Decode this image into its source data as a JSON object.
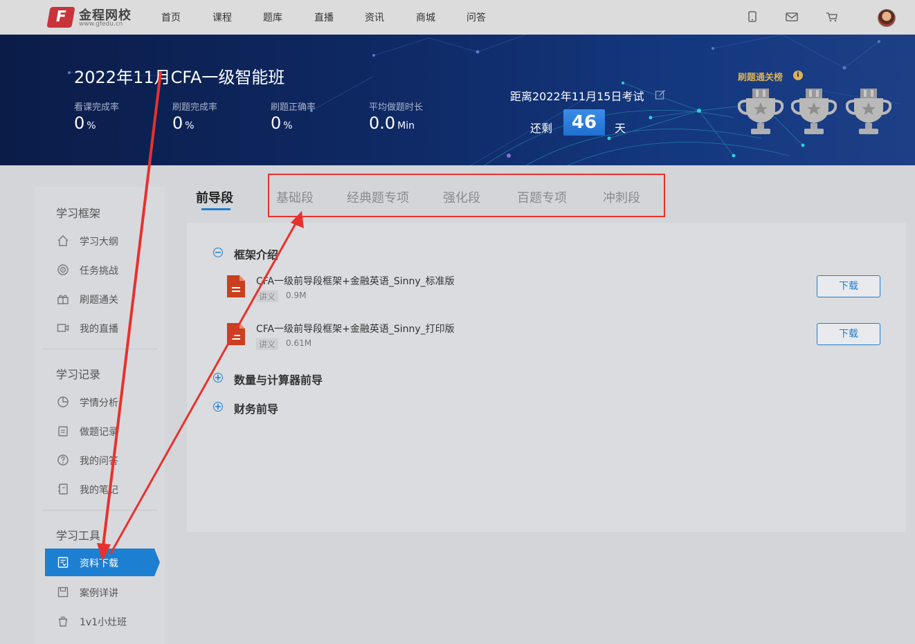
{
  "logo": {
    "mark": "F",
    "name": "金程网校",
    "url": "www.gfedu.cn"
  },
  "nav": [
    "首页",
    "课程",
    "题库",
    "直播",
    "资讯",
    "商城",
    "问答"
  ],
  "course": {
    "title": "2022年11月CFA一级智能班"
  },
  "stats": [
    {
      "label": "看课完成率",
      "value": "0",
      "unit": "%"
    },
    {
      "label": "刷题完成率",
      "value": "0",
      "unit": "%"
    },
    {
      "label": "刷题正确率",
      "value": "0",
      "unit": "%"
    },
    {
      "label": "平均做题时长",
      "value": "0.0",
      "unit": "Min"
    }
  ],
  "exam": {
    "text": "距离2022年11月15日考试",
    "remain_label": "还剩",
    "days": "46",
    "day_unit": "天"
  },
  "ranking": {
    "title": "刷题通关榜",
    "info": "i"
  },
  "sidebar": {
    "sections": [
      {
        "heading": "学习框架",
        "items": [
          "学习大纲",
          "任务挑战",
          "刷题通关",
          "我的直播"
        ]
      },
      {
        "heading": "学习记录",
        "items": [
          "学情分析",
          "做题记录",
          "我的问答",
          "我的笔记"
        ]
      },
      {
        "heading": "学习工具",
        "items": [
          "资料下载",
          "案例详讲",
          "1v1小灶班"
        ]
      }
    ],
    "active": "资料下载"
  },
  "tabs": [
    "前导段",
    "基础段",
    "经典题专项",
    "强化段",
    "百题专项",
    "冲刺段"
  ],
  "sections": [
    {
      "title": "框架介绍",
      "toggle": "−",
      "files": [
        {
          "name": "CFA一级前导段框架+金融英语_Sinny_标准版",
          "tag": "讲义",
          "size": "0.9M",
          "button": "下载"
        },
        {
          "name": "CFA一级前导段框架+金融英语_Sinny_打印版",
          "tag": "讲义",
          "size": "0.61M",
          "button": "下载"
        }
      ]
    },
    {
      "title": "数量与计算器前导",
      "toggle": "+"
    },
    {
      "title": "财务前导",
      "toggle": "+"
    }
  ],
  "colors": {
    "accent": "#1c7fd1",
    "annotation": "#e8312e",
    "gold": "#d9b25a",
    "banner": "#0f2a66"
  }
}
